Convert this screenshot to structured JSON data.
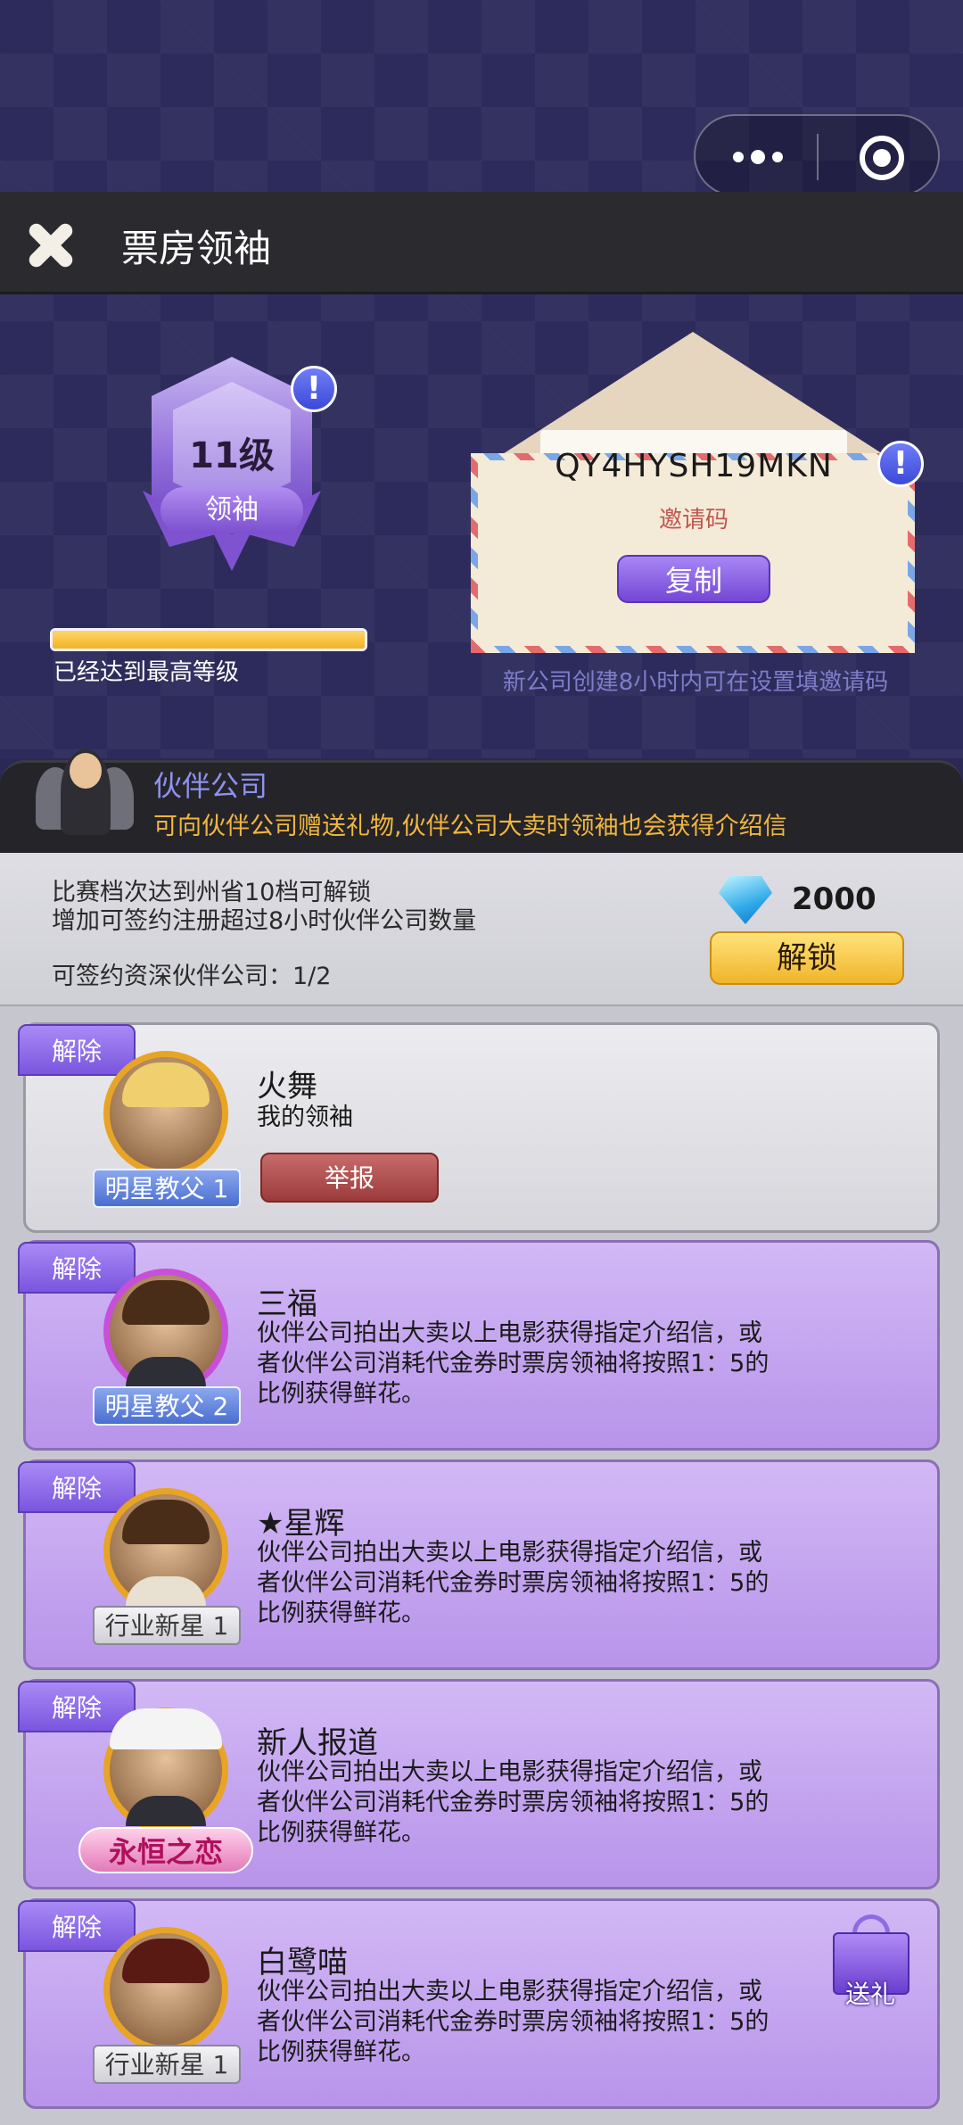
{
  "header": {
    "title": "票房领袖"
  },
  "level_badge": {
    "level": "11级",
    "title": "领袖",
    "info_icon": "info-icon",
    "progress": 1.0,
    "progress_caption": "已经达到最高等级"
  },
  "invite": {
    "code": "QY4HYSH19MKN",
    "label": "邀请码",
    "copy_button": "复制",
    "hint": "新公司创建8小时内可在设置填邀请码"
  },
  "partners": {
    "title": "伙伴公司",
    "description": "可向伙伴公司赠送礼物,伙伴公司大卖时领袖也会获得介绍信",
    "unlock": {
      "line1": "比赛档次达到州省10档可解锁",
      "line2": "增加可签约注册超过8小时伙伴公司数量",
      "line3": "可签约资深伙伴公司：1/2",
      "diamond_cost": "2000",
      "unlock_button": "解锁"
    },
    "remove_label": "解除",
    "report_label": "举报",
    "gift_label": "送礼",
    "items": [
      {
        "name": "火舞",
        "subtitle": "我的领袖",
        "rank": "明星教父 1"
      },
      {
        "name": "三福",
        "desc": "伙伴公司拍出大卖以上电影获得指定介绍信，或者伙伴公司消耗代金券时票房领袖将按照1：5的比例获得鲜花。",
        "rank": "明星教父 2"
      },
      {
        "name": "★星辉",
        "desc": "伙伴公司拍出大卖以上电影获得指定介绍信，或者伙伴公司消耗代金券时票房领袖将按照1：5的比例获得鲜花。",
        "rank": "行业新星 1"
      },
      {
        "name": "新人报道",
        "desc": "伙伴公司拍出大卖以上电影获得指定介绍信，或者伙伴公司消耗代金券时票房领袖将按照1：5的比例获得鲜花。",
        "rank": "永恒之恋"
      },
      {
        "name": "白鹭喵",
        "desc": "伙伴公司拍出大卖以上电影获得指定介绍信，或者伙伴公司消耗代金券时票房领袖将按照1：5的比例获得鲜花。",
        "rank": "行业新星 1"
      }
    ]
  }
}
